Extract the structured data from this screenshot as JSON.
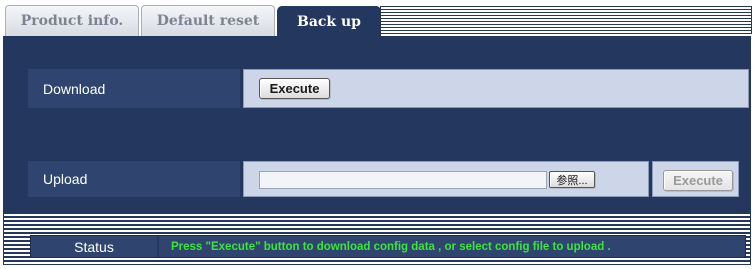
{
  "tabs": [
    {
      "label": "Product info.",
      "active": false
    },
    {
      "label": "Default reset",
      "active": false
    },
    {
      "label": "Back up",
      "active": true
    }
  ],
  "download": {
    "label": "Download",
    "execute_label": "Execute"
  },
  "upload": {
    "label": "Upload",
    "file_value": "",
    "browse_label": "参照...",
    "execute_label": "Execute",
    "execute_enabled": false
  },
  "status": {
    "label": "Status",
    "message": "Press \"Execute\" button to download config data , or select config file to upload ."
  },
  "colors": {
    "panel_bg": "#23375f",
    "label_bg": "#2f4570",
    "value_bg": "#ccd6e8",
    "status_text": "#39e639"
  }
}
